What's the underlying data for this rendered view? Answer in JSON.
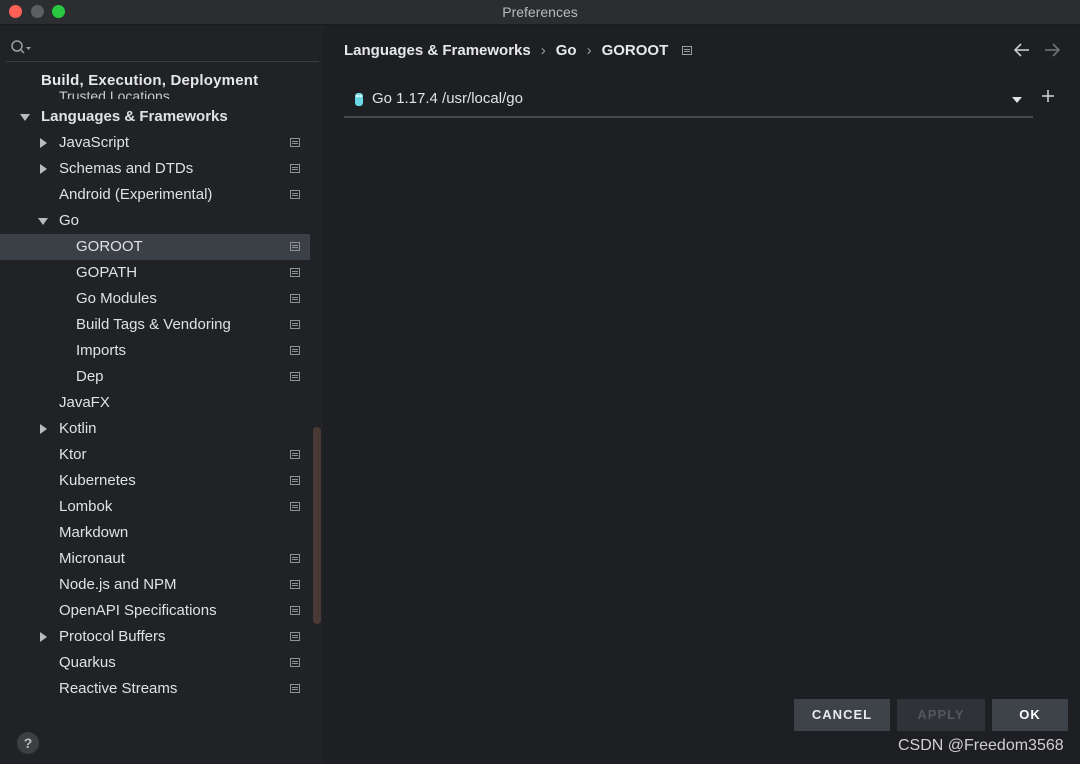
{
  "window": {
    "title": "Preferences"
  },
  "sidebar": {
    "section_header": "Build, Execution, Deployment",
    "section_sub": "Trusted Locations",
    "items": [
      {
        "label": "Languages & Frameworks",
        "arrow": "expanded",
        "bold": true,
        "indent": 0,
        "page_icon": false
      },
      {
        "label": "JavaScript",
        "arrow": "collapsed",
        "bold": false,
        "indent": 1,
        "page_icon": true
      },
      {
        "label": "Schemas and DTDs",
        "arrow": "collapsed",
        "bold": false,
        "indent": 1,
        "page_icon": true
      },
      {
        "label": "Android (Experimental)",
        "arrow": "none",
        "bold": false,
        "indent": 1,
        "page_icon": true
      },
      {
        "label": "Go",
        "arrow": "expanded",
        "bold": false,
        "indent": 1,
        "page_icon": false
      },
      {
        "label": "GOROOT",
        "arrow": "none",
        "bold": false,
        "indent": 2,
        "page_icon": true,
        "selected": true
      },
      {
        "label": "GOPATH",
        "arrow": "none",
        "bold": false,
        "indent": 2,
        "page_icon": true
      },
      {
        "label": "Go Modules",
        "arrow": "none",
        "bold": false,
        "indent": 2,
        "page_icon": true
      },
      {
        "label": "Build Tags & Vendoring",
        "arrow": "none",
        "bold": false,
        "indent": 2,
        "page_icon": true
      },
      {
        "label": "Imports",
        "arrow": "none",
        "bold": false,
        "indent": 2,
        "page_icon": true
      },
      {
        "label": "Dep",
        "arrow": "none",
        "bold": false,
        "indent": 2,
        "page_icon": true
      },
      {
        "label": "JavaFX",
        "arrow": "none",
        "bold": false,
        "indent": 1,
        "page_icon": false
      },
      {
        "label": "Kotlin",
        "arrow": "collapsed",
        "bold": false,
        "indent": 1,
        "page_icon": false
      },
      {
        "label": "Ktor",
        "arrow": "none",
        "bold": false,
        "indent": 1,
        "page_icon": true
      },
      {
        "label": "Kubernetes",
        "arrow": "none",
        "bold": false,
        "indent": 1,
        "page_icon": true
      },
      {
        "label": "Lombok",
        "arrow": "none",
        "bold": false,
        "indent": 1,
        "page_icon": true
      },
      {
        "label": "Markdown",
        "arrow": "none",
        "bold": false,
        "indent": 1,
        "page_icon": false
      },
      {
        "label": "Micronaut",
        "arrow": "none",
        "bold": false,
        "indent": 1,
        "page_icon": true
      },
      {
        "label": "Node.js and NPM",
        "arrow": "none",
        "bold": false,
        "indent": 1,
        "page_icon": true
      },
      {
        "label": "OpenAPI Specifications",
        "arrow": "none",
        "bold": false,
        "indent": 1,
        "page_icon": true
      },
      {
        "label": "Protocol Buffers",
        "arrow": "collapsed",
        "bold": false,
        "indent": 1,
        "page_icon": true
      },
      {
        "label": "Quarkus",
        "arrow": "none",
        "bold": false,
        "indent": 1,
        "page_icon": true
      },
      {
        "label": "Reactive Streams",
        "arrow": "none",
        "bold": false,
        "indent": 1,
        "page_icon": true
      }
    ],
    "help_label": "?"
  },
  "main": {
    "breadcrumb": [
      "Languages & Frameworks",
      "Go",
      "GOROOT"
    ],
    "sdk": {
      "value": "Go 1.17.4 /usr/local/go"
    }
  },
  "buttons": {
    "cancel": "CANCEL",
    "apply": "APPLY",
    "ok": "OK"
  },
  "watermark": "CSDN @Freedom3568",
  "colors": {
    "selection": "#3b3f46",
    "background": "#1e1f22",
    "sidebar": "#212225",
    "go_gopher": "#6ad7e5"
  },
  "icons": [
    "search-icon",
    "page-settings-icon",
    "back-arrow-icon",
    "forward-arrow-icon",
    "go-sdk-icon",
    "dropdown-arrow-icon",
    "plus-icon",
    "help-icon"
  ]
}
